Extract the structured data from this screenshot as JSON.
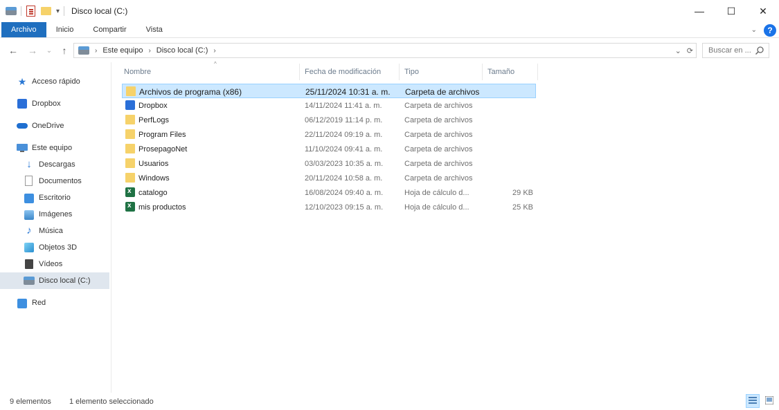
{
  "window": {
    "title": "Disco local (C:)",
    "controls": {
      "minimize": "—",
      "maximize": "☐",
      "close": "✕"
    }
  },
  "ribbon": {
    "tabs": [
      {
        "label": "Archivo",
        "active": true
      },
      {
        "label": "Inicio"
      },
      {
        "label": "Compartir"
      },
      {
        "label": "Vista"
      }
    ],
    "help": "?"
  },
  "nav": {
    "back": "←",
    "forward": "→",
    "recent": "⌄",
    "up": "↑"
  },
  "address": {
    "crumbs": [
      "Este equipo",
      "Disco local (C:)"
    ],
    "search_placeholder": "Buscar en ..."
  },
  "sidebar": {
    "items": [
      {
        "label": "Acceso rápido",
        "icon": "star-icon",
        "level": 0
      },
      {
        "label": "Dropbox",
        "icon": "dropbox-icon",
        "level": 0
      },
      {
        "label": "OneDrive",
        "icon": "cloud-icon",
        "level": 0
      },
      {
        "label": "Este equipo",
        "icon": "computer-icon",
        "level": 0
      },
      {
        "label": "Descargas",
        "icon": "download-icon",
        "level": 1
      },
      {
        "label": "Documentos",
        "icon": "document-icon",
        "level": 1
      },
      {
        "label": "Escritorio",
        "icon": "desktop-icon",
        "level": 1
      },
      {
        "label": "Imágenes",
        "icon": "image-icon",
        "level": 1
      },
      {
        "label": "Música",
        "icon": "music-icon",
        "level": 1
      },
      {
        "label": "Objetos 3D",
        "icon": "cube-icon",
        "level": 1
      },
      {
        "label": "Vídeos",
        "icon": "video-icon",
        "level": 1
      },
      {
        "label": "Disco local (C:)",
        "icon": "drive-icon",
        "level": 1,
        "selected": true
      },
      {
        "label": "Red",
        "icon": "network-icon",
        "level": 0
      }
    ]
  },
  "columns": {
    "name": "Nombre",
    "date": "Fecha de modificación",
    "type": "Tipo",
    "size": "Tamaño"
  },
  "files": [
    {
      "name": "Archivos de programa (x86)",
      "date": "25/11/2024 10:31 a. m.",
      "type": "Carpeta de archivos",
      "size": "",
      "icon": "folder-icon",
      "selected": true
    },
    {
      "name": "Dropbox",
      "date": "14/11/2024 11:41 a. m.",
      "type": "Carpeta de archivos",
      "size": "",
      "icon": "dropbox-icon"
    },
    {
      "name": "PerfLogs",
      "date": "06/12/2019 11:14 p. m.",
      "type": "Carpeta de archivos",
      "size": "",
      "icon": "folder-icon"
    },
    {
      "name": "Program Files",
      "date": "22/11/2024 09:19 a. m.",
      "type": "Carpeta de archivos",
      "size": "",
      "icon": "folder-icon"
    },
    {
      "name": "ProsepagoNet",
      "date": "11/10/2024 09:41 a. m.",
      "type": "Carpeta de archivos",
      "size": "",
      "icon": "folder-icon"
    },
    {
      "name": "Usuarios",
      "date": "03/03/2023 10:35 a. m.",
      "type": "Carpeta de archivos",
      "size": "",
      "icon": "folder-icon"
    },
    {
      "name": "Windows",
      "date": "20/11/2024 10:58 a. m.",
      "type": "Carpeta de archivos",
      "size": "",
      "icon": "folder-icon"
    },
    {
      "name": "catalogo",
      "date": "16/08/2024 09:40 a. m.",
      "type": "Hoja de cálculo d...",
      "size": "29 KB",
      "icon": "excel-icon"
    },
    {
      "name": "mis productos",
      "date": "12/10/2023 09:15 a. m.",
      "type": "Hoja de cálculo d...",
      "size": "25 KB",
      "icon": "excel-icon"
    }
  ],
  "status": {
    "count": "9 elementos",
    "selection": "1 elemento seleccionado"
  },
  "colors": {
    "accent": "#1f6fbf",
    "selection_bg": "#cce8ff",
    "selection_border": "#99d1ff"
  }
}
